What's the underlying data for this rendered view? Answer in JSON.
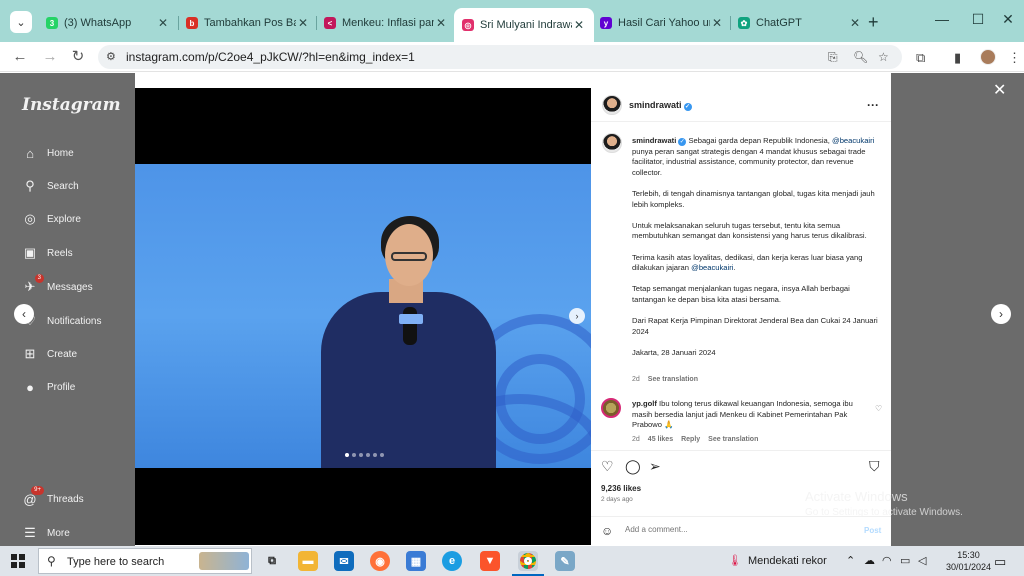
{
  "browser": {
    "tabs": [
      {
        "title": "(3) WhatsApp",
        "icon": "whatsapp-icon",
        "color": "#25d366",
        "badge": "3"
      },
      {
        "title": "Tambahkan Pos Baru",
        "icon": "blog-icon",
        "color": "#d93025"
      },
      {
        "title": "Menkeu: Inflasi panga",
        "icon": "news-icon",
        "color": "#c2185b"
      },
      {
        "title": "Sri Mulyani Indrawati",
        "icon": "instagram-icon",
        "color": "#e1306c"
      },
      {
        "title": "Hasil Cari Yahoo untu",
        "icon": "yahoo-icon",
        "color": "#6001d2"
      },
      {
        "title": "ChatGPT",
        "icon": "chatgpt-icon",
        "color": "#10a37f"
      }
    ],
    "active_tab": 3,
    "url": "instagram.com/p/C2oe4_pJkCW/?hl=en&img_index=1"
  },
  "instagram": {
    "logo": "Instagram",
    "nav": [
      {
        "label": "Home",
        "icon": "home-icon"
      },
      {
        "label": "Search",
        "icon": "search-icon"
      },
      {
        "label": "Explore",
        "icon": "explore-icon"
      },
      {
        "label": "Reels",
        "icon": "reels-icon"
      },
      {
        "label": "Messages",
        "icon": "messages-icon",
        "badge": "3"
      },
      {
        "label": "Notifications",
        "icon": "heart-icon"
      },
      {
        "label": "Create",
        "icon": "create-icon"
      },
      {
        "label": "Profile",
        "icon": "profile-icon"
      }
    ],
    "bottom_nav": [
      {
        "label": "Threads",
        "icon": "threads-icon",
        "badge": "9+"
      },
      {
        "label": "More",
        "icon": "menu-icon"
      }
    ],
    "post": {
      "username": "smindrawati",
      "caption": {
        "username": "smindrawati",
        "p1_before": "Sebagai garda depan Republik Indonesia, ",
        "p1_mention": "@beacukairi",
        "p1_after": " punya peran sangat strategis dengan 4 mandat khusus sebagai trade facilitator, industrial assistance, community protector, dan revenue collector.",
        "p2": "Terlebih, di tengah dinamisnya tantangan global, tugas kita menjadi jauh lebih kompleks.",
        "p3": "Untuk melaksanakan seluruh tugas tersebut, tentu kita semua membutuhkan semangat dan konsistensi yang harus terus dikalibrasi.",
        "p4_before": "Terima kasih atas loyalitas, dedikasi, dan kerja keras luar biasa yang dilakukan jajaran ",
        "p4_mention": "@beacukairi",
        "p4_after": ".",
        "p5": "Tetap semangat menjalankan tugas negara, insya Allah berbagai tantangan ke depan bisa kita atasi bersama.",
        "p6": "Dari Rapat Kerja Pimpinan Direktorat Jenderal Bea dan Cukai 24 Januari 2024",
        "p7": "Jakarta, 28 Januari 2024"
      },
      "caption_age": "2d",
      "see_translation": "See translation",
      "comment": {
        "username": "yp.golf",
        "text": "Ibu tolong terus dikawal keuangan Indonesia, semoga ibu masih bersedia lanjut jadi Menkeu di Kabinet Pemerintahan Pak Prabowo 🙏",
        "age": "2d",
        "likes": "45 likes",
        "reply": "Reply",
        "see_translation": "See translation"
      },
      "likes": "9,236 likes",
      "posted": "2 days ago",
      "add_comment_placeholder": "Add a comment...",
      "post_label": "Post",
      "carousel_count": 6,
      "carousel_index": 1
    }
  },
  "watermark": {
    "line1": "Activate Windows",
    "line2": "Go to Settings to activate Windows."
  },
  "taskbar": {
    "search_placeholder": "Type here to search",
    "weather": "Mendekati rekor",
    "time": "15:30",
    "date": "30/01/2024"
  }
}
